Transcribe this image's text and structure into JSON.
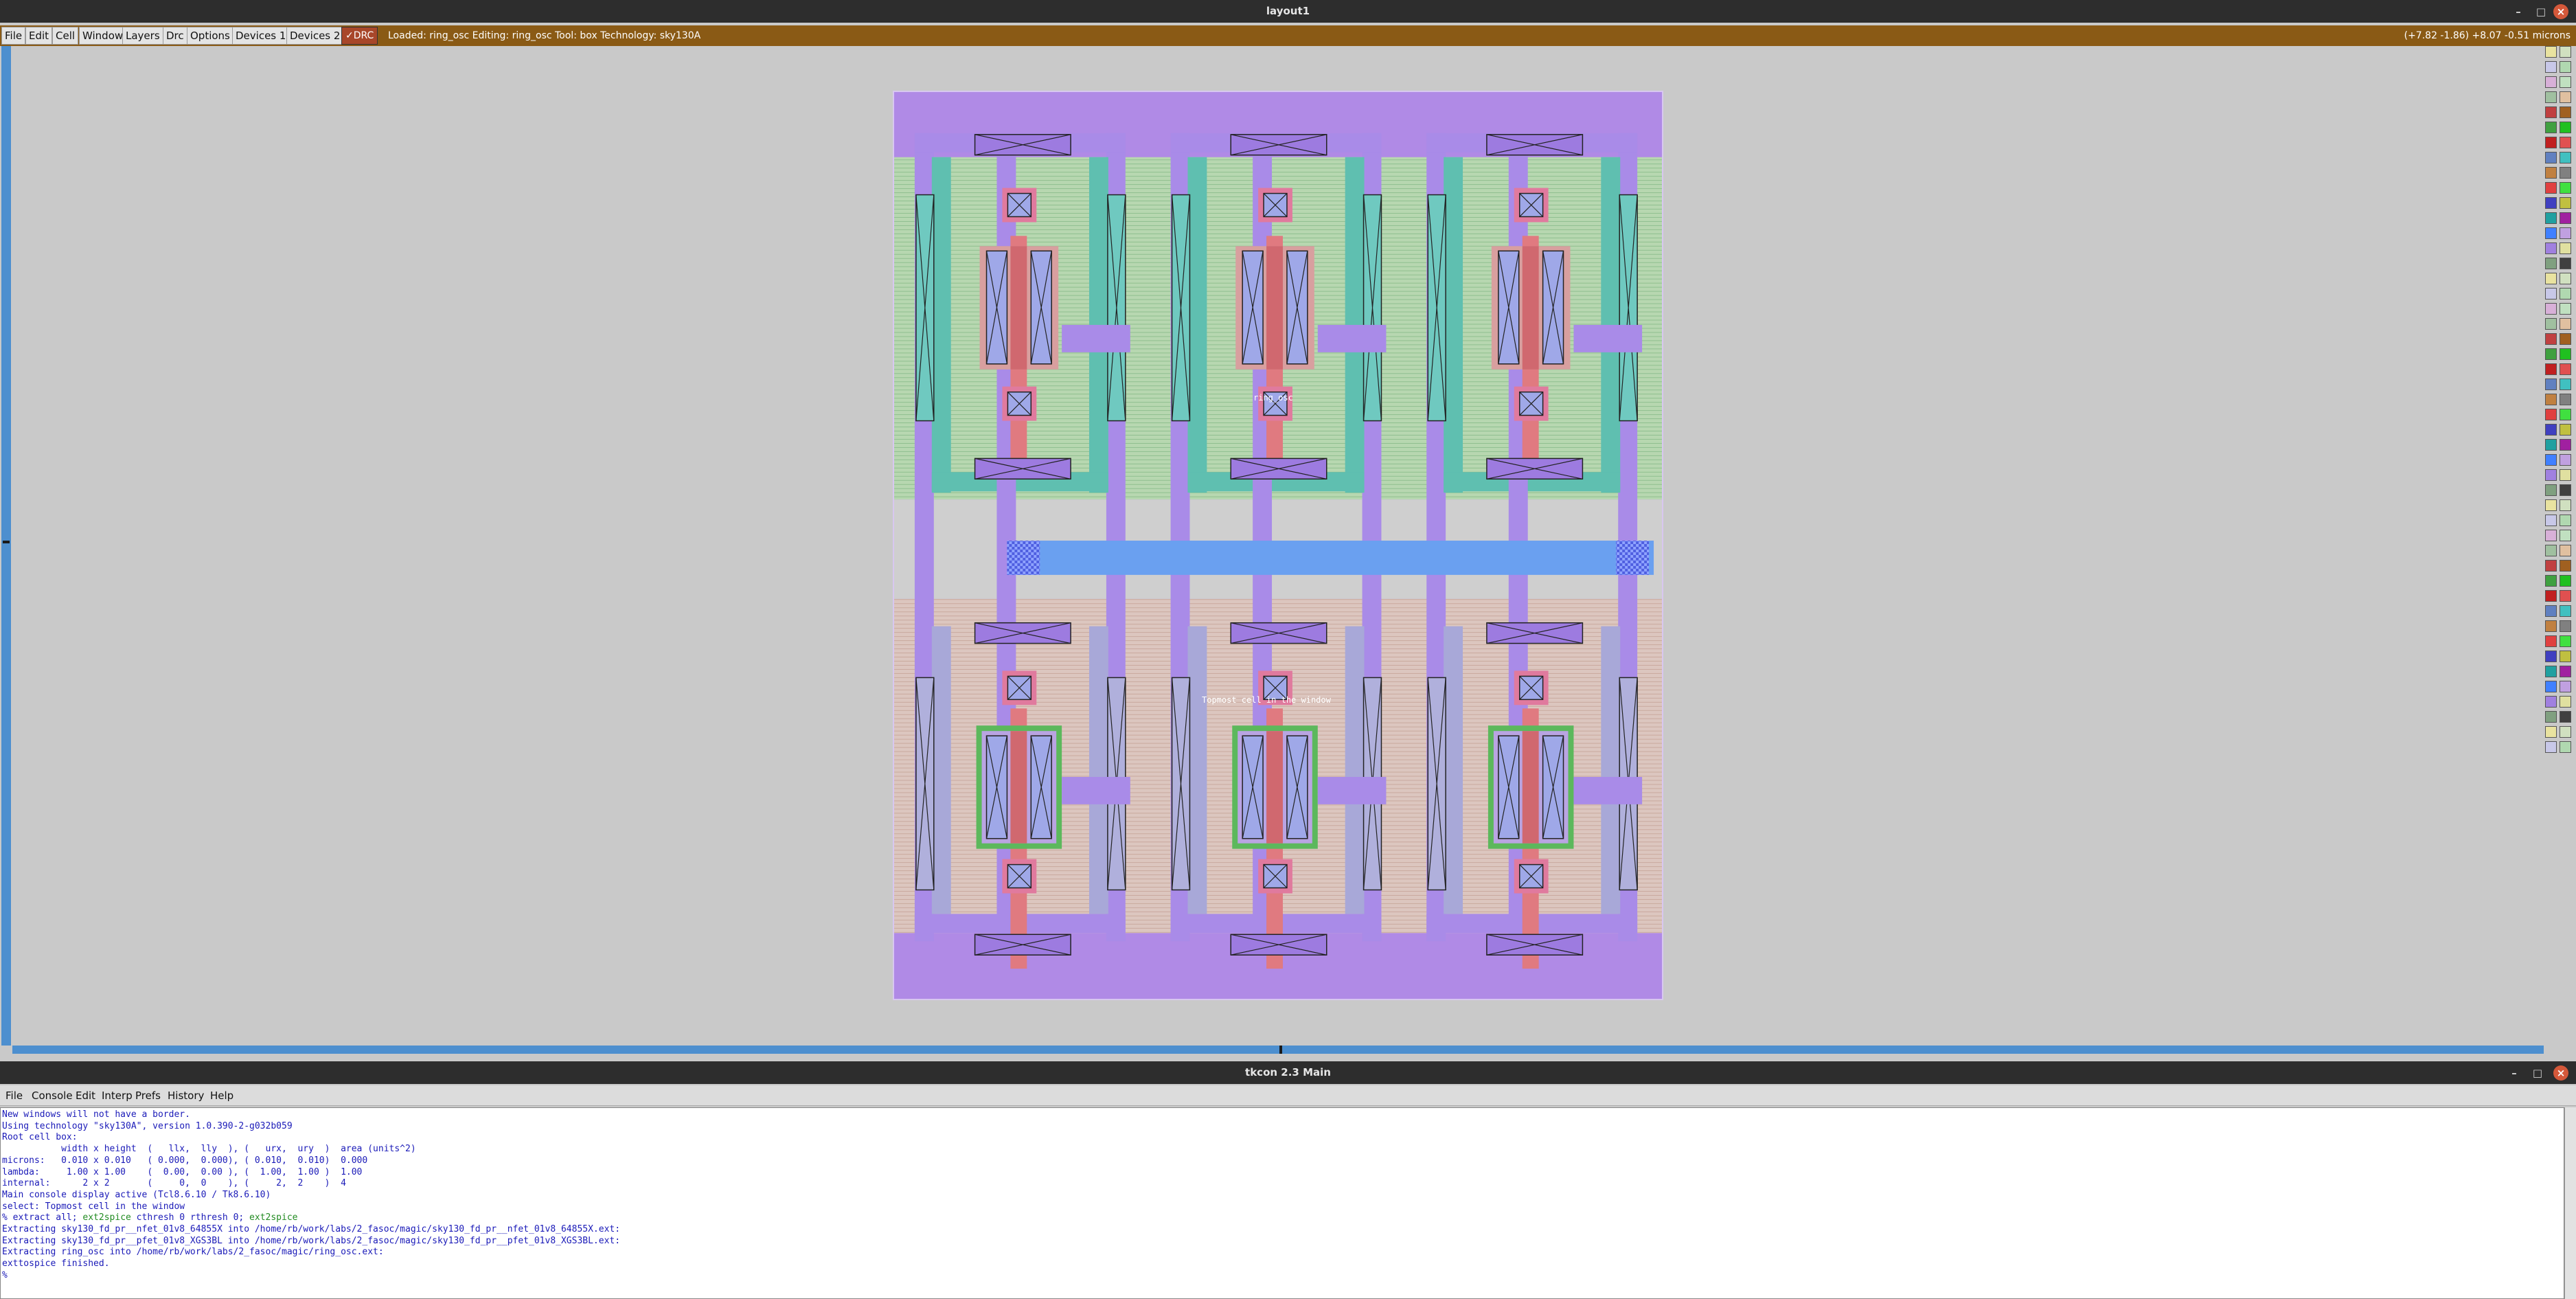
{
  "magic": {
    "title": "layout1",
    "menu": [
      "File",
      "Edit",
      "Cell",
      "Window",
      "Layers",
      "Drc",
      "Options",
      "Devices 1",
      "Devices 2"
    ],
    "drc_label": "DRC",
    "status": "Loaded: ring_osc Editing: ring_osc Tool: box  Technology: sky130A",
    "coords": "(+7.82 -1.86) +8.07 -0.51 microns",
    "window_buttons": [
      "–",
      "□",
      "×"
    ],
    "canvas_labels": {
      "top_cell": "ring_osc",
      "bottom_cell": "Topmost cell in the window"
    }
  },
  "tkcon": {
    "title": "tkcon 2.3 Main",
    "menu": [
      "File",
      "Console",
      "Edit",
      "Interp",
      "Prefs",
      "History",
      "Help"
    ],
    "lines": [
      "New windows will not have a border.",
      "Using technology \"sky130A\", version 1.0.390-2-g032b059",
      "Root cell box:",
      "           width x height  (   llx,  lly  ), (   urx,  ury  )  area (units^2)",
      "",
      "microns:   0.010 x 0.010   ( 0.000,  0.000), ( 0.010,  0.010)  0.000",
      "lambda:     1.00 x 1.00    (  0.00,  0.00 ), (  1.00,  1.00 )  1.00",
      "internal:      2 x 2       (     0,  0    ), (     2,  2    )  4",
      "Main console display active (Tcl8.6.10 / Tk8.6.10)",
      "select: Topmost cell in the window",
      "% extract all; ext2spice cthresh 0 rthresh 0; ext2spice",
      "Extracting sky130_fd_pr__nfet_01v8_64855X into /home/rb/work/labs/2_fasoc/magic/sky130_fd_pr__nfet_01v8_64855X.ext:",
      "Extracting sky130_fd_pr__pfet_01v8_XGS3BL into /home/rb/work/labs/2_fasoc/magic/sky130_fd_pr__pfet_01v8_XGS3BL.ext:",
      "Extracting ring_osc into /home/rb/work/labs/2_fasoc/magic/ring_osc.ext:",
      "exttospice finished.",
      "% "
    ]
  },
  "colors": {
    "metal1": "#b18af0",
    "poly": "#e07a80",
    "ndiff": "#a8d8a8",
    "pdiff": "#d8b8a8",
    "metal2": "#6aa0f0",
    "local_interconnect": "#7ec8c8",
    "menubar": "#8a5a15"
  }
}
